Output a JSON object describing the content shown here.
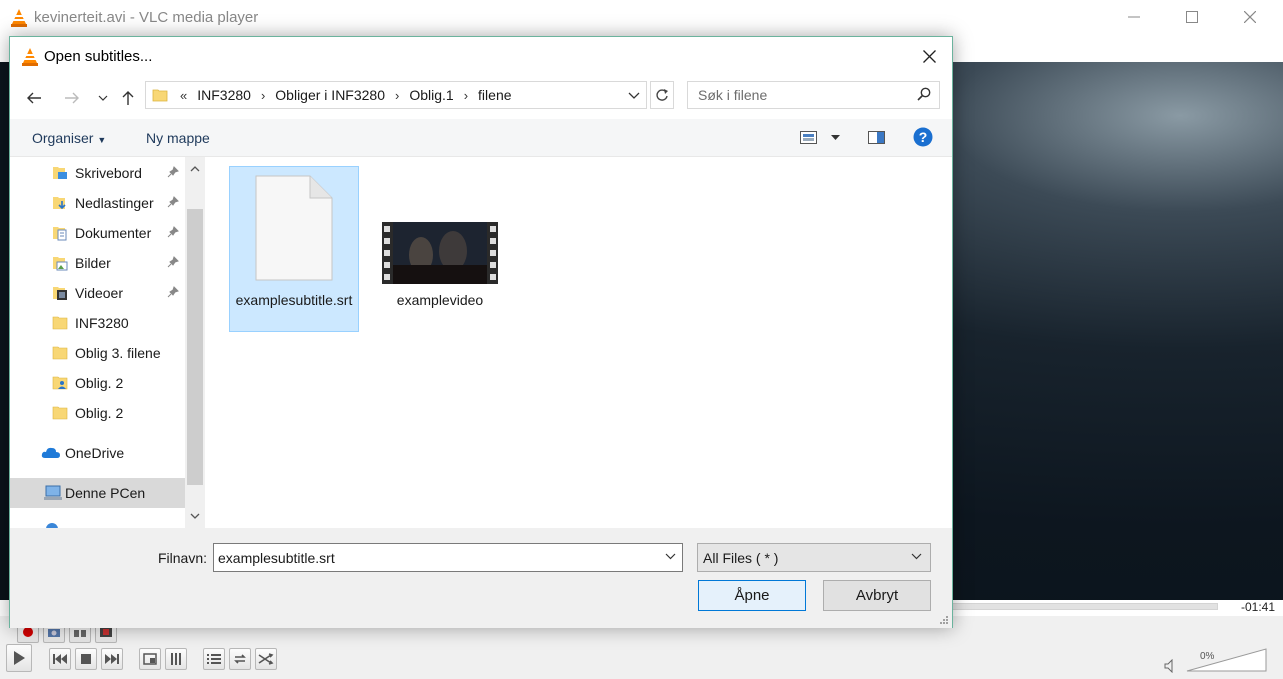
{
  "vlc": {
    "window_title": "kevinerteit.avi - VLC media player",
    "remaining_time": "-01:41",
    "volume_label": "0%"
  },
  "dialog": {
    "title": "Open subtitles...",
    "breadcrumb": [
      "INF3280",
      "Obliger i INF3280",
      "Oblig.1",
      "filene"
    ],
    "breadcrumb_overflow": "«",
    "search_placeholder": "Søk i filene",
    "toolbar": {
      "organise_label": "Organiser",
      "new_folder_label": "Ny mappe"
    },
    "nav_items": [
      {
        "label": "Skrivebord",
        "icon": "desktop-folder-icon",
        "pinned": true
      },
      {
        "label": "Nedlastinger",
        "icon": "downloads-folder-icon",
        "pinned": true
      },
      {
        "label": "Dokumenter",
        "icon": "documents-folder-icon",
        "pinned": true
      },
      {
        "label": "Bilder",
        "icon": "pictures-folder-icon",
        "pinned": true
      },
      {
        "label": "Videoer",
        "icon": "videos-folder-icon",
        "pinned": true
      },
      {
        "label": "INF3280",
        "icon": "folder-icon",
        "pinned": false
      },
      {
        "label": "Oblig 3. filene",
        "icon": "folder-icon",
        "pinned": false
      },
      {
        "label": "Oblig. 2",
        "icon": "user-folder-icon",
        "pinned": false
      },
      {
        "label": "Oblig. 2",
        "icon": "folder-icon",
        "pinned": false
      },
      {
        "label": "OneDrive",
        "icon": "onedrive-icon",
        "pinned": false
      },
      {
        "label": "Denne PCen",
        "icon": "computer-icon",
        "pinned": false,
        "selected": true
      }
    ],
    "files": [
      {
        "name": "examplesubtitle.srt",
        "type": "document",
        "selected": true
      },
      {
        "name": "examplevideo",
        "type": "video",
        "selected": false
      }
    ],
    "filename_label": "Filnavn:",
    "filename_value": "examplesubtitle.srt",
    "file_type_filter": "All Files ( * )",
    "open_button": "Åpne",
    "cancel_button": "Avbryt"
  },
  "colors": {
    "accent": "#0078d7",
    "selection_bg": "#cce8ff",
    "vlc_orange": "#ff8800",
    "help_blue": "#1a6fd0"
  }
}
